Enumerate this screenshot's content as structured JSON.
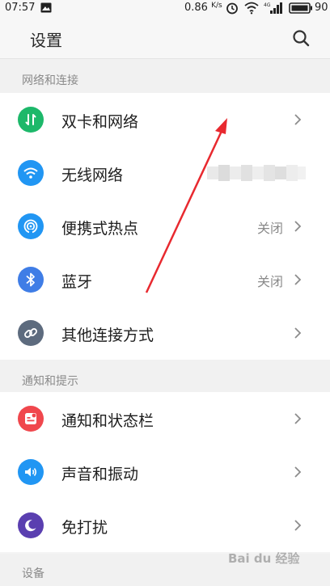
{
  "status_bar": {
    "time": "07:57",
    "speed": "0.86",
    "speed_unit": "K/s",
    "battery": "90"
  },
  "header": {
    "title": "设置"
  },
  "sections": {
    "network": {
      "title": "网络和连接",
      "items": [
        {
          "label": "双卡和网络",
          "icon": "dual-sim-icon",
          "color": "#1db86a",
          "value": ""
        },
        {
          "label": "无线网络",
          "icon": "wifi-icon",
          "color": "#2196f3",
          "value": ""
        },
        {
          "label": "便携式热点",
          "icon": "hotspot-icon",
          "color": "#2196f3",
          "value": "关闭"
        },
        {
          "label": "蓝牙",
          "icon": "bluetooth-icon",
          "color": "#3f7de6",
          "value": "关闭"
        },
        {
          "label": "其他连接方式",
          "icon": "link-icon",
          "color": "#5d6b7e",
          "value": ""
        }
      ]
    },
    "notifications": {
      "title": "通知和提示",
      "items": [
        {
          "label": "通知和状态栏",
          "icon": "notification-icon",
          "color": "#f0474d",
          "value": ""
        },
        {
          "label": "声音和振动",
          "icon": "sound-icon",
          "color": "#2196f3",
          "value": ""
        },
        {
          "label": "免打扰",
          "icon": "moon-icon",
          "color": "#5a3fb0",
          "value": ""
        }
      ]
    },
    "device": {
      "title": "设备"
    }
  },
  "watermark": "Bai du 经验"
}
